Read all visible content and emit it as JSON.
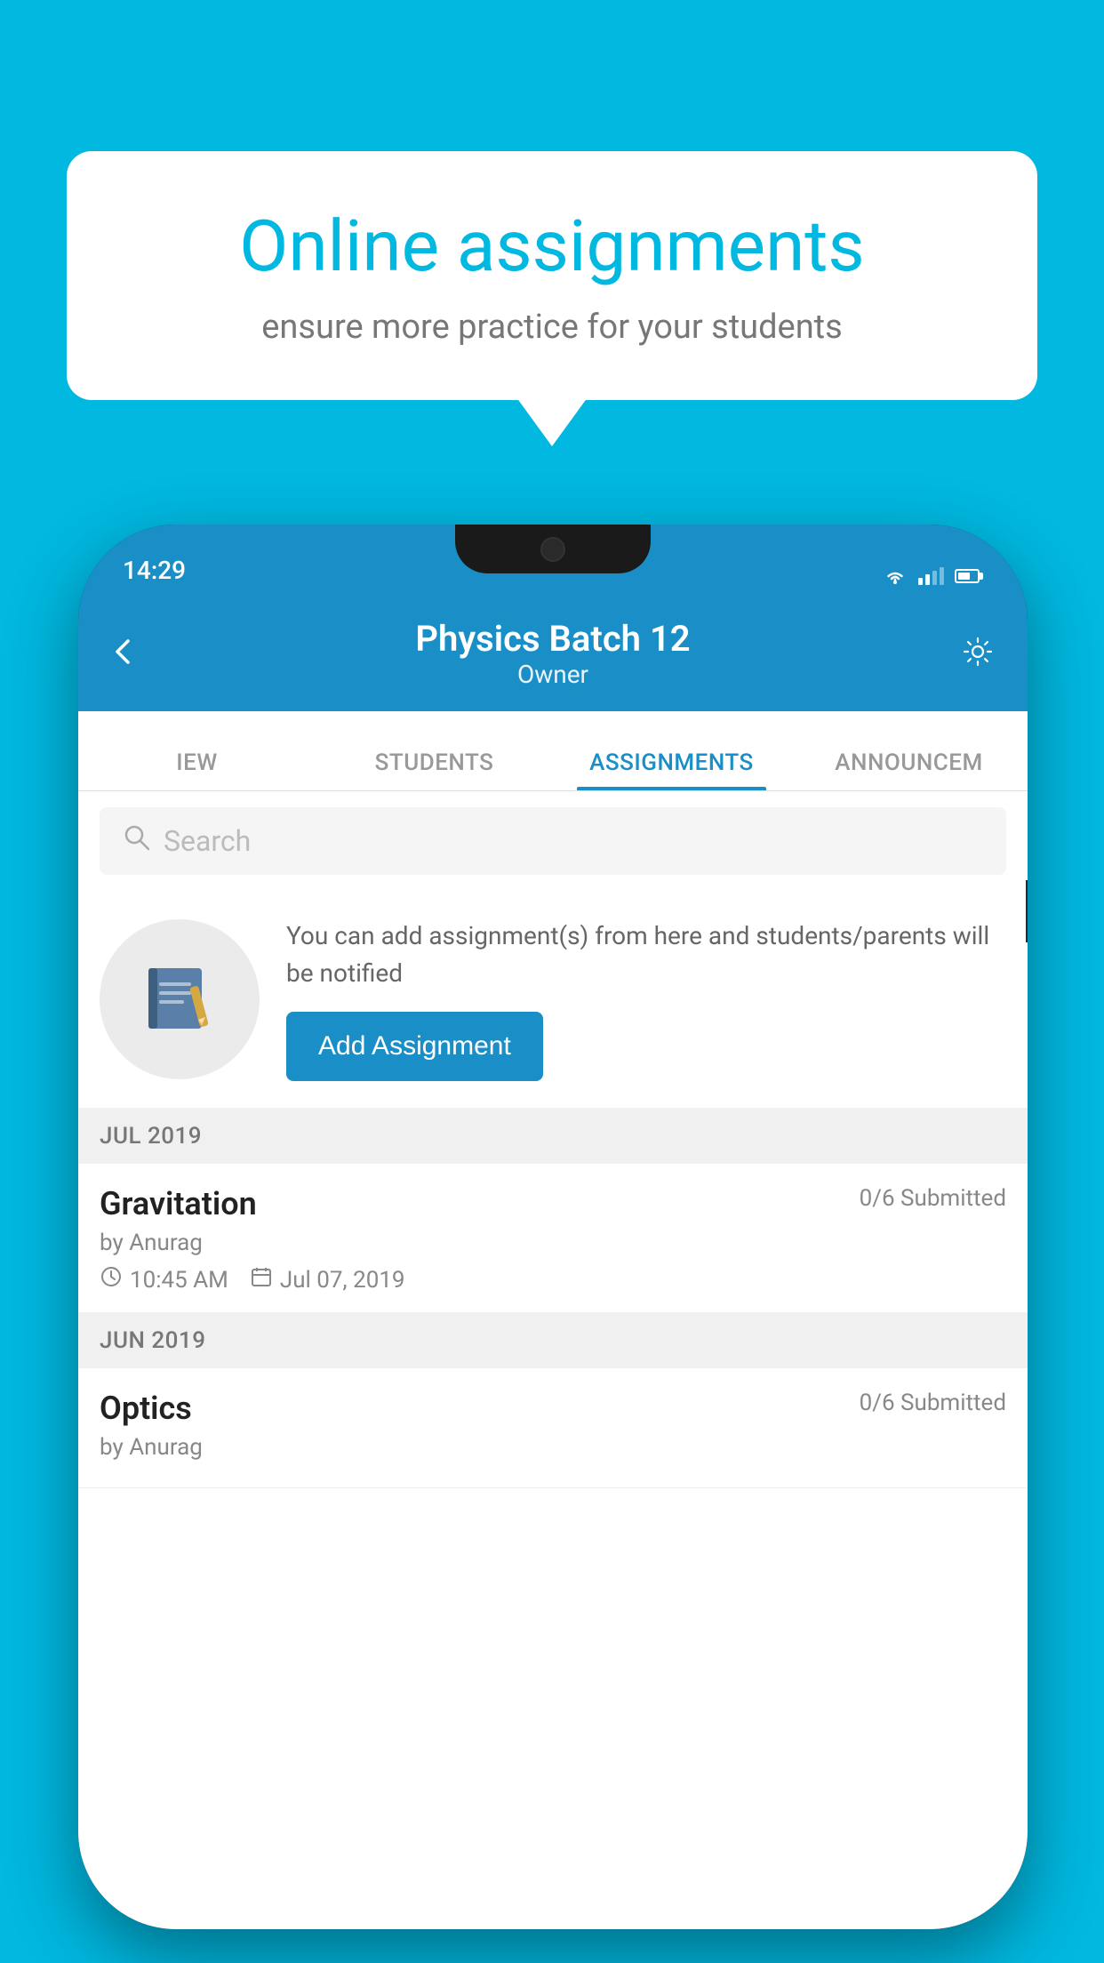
{
  "background_color": "#00b8e0",
  "speech_bubble": {
    "title": "Online assignments",
    "subtitle": "ensure more practice for your students"
  },
  "phone": {
    "status_bar": {
      "time": "14:29"
    },
    "header": {
      "title": "Physics Batch 12",
      "subtitle": "Owner",
      "back_label": "back",
      "settings_label": "settings"
    },
    "tabs": [
      {
        "label": "IEW",
        "active": false
      },
      {
        "label": "STUDENTS",
        "active": false
      },
      {
        "label": "ASSIGNMENTS",
        "active": true
      },
      {
        "label": "ANNOUNCEM",
        "active": false
      }
    ],
    "search": {
      "placeholder": "Search"
    },
    "info_card": {
      "description": "You can add assignment(s) from here and students/parents will be notified",
      "button_label": "Add Assignment"
    },
    "sections": [
      {
        "label": "JUL 2019",
        "assignments": [
          {
            "name": "Gravitation",
            "submitted": "0/6 Submitted",
            "author": "by Anurag",
            "time": "10:45 AM",
            "date": "Jul 07, 2019"
          }
        ]
      },
      {
        "label": "JUN 2019",
        "assignments": [
          {
            "name": "Optics",
            "submitted": "0/6 Submitted",
            "author": "by Anurag",
            "time": "",
            "date": ""
          }
        ]
      }
    ]
  }
}
